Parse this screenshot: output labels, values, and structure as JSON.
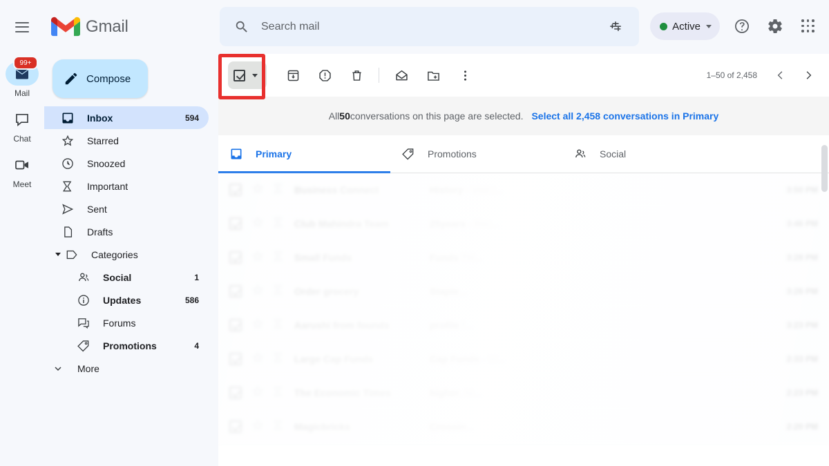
{
  "app": {
    "brand": "Gmail",
    "menu_icon": "hamburger-icon"
  },
  "search": {
    "placeholder": "Search mail",
    "value": "",
    "icon": "search-icon",
    "options_icon": "search-options-icon"
  },
  "header": {
    "status_label": "Active",
    "status_color": "#1e8e3e",
    "help_label": "Support",
    "settings_label": "Settings",
    "apps_label": "Google apps"
  },
  "rail": {
    "items": [
      {
        "label": "Mail",
        "icon": "mail-icon",
        "badge": "99+",
        "active": true
      },
      {
        "label": "Chat",
        "icon": "chat-icon",
        "badge": "",
        "active": false
      },
      {
        "label": "Meet",
        "icon": "meet-icon",
        "badge": "",
        "active": false
      }
    ]
  },
  "sidebar": {
    "compose_label": "Compose",
    "items": [
      {
        "label": "Inbox",
        "count": "594",
        "icon": "inbox-icon",
        "active": true,
        "bold": true,
        "level": "top"
      },
      {
        "label": "Starred",
        "count": "",
        "icon": "star-icon",
        "active": false,
        "bold": false,
        "level": "top"
      },
      {
        "label": "Snoozed",
        "count": "",
        "icon": "clock-icon",
        "active": false,
        "bold": false,
        "level": "top"
      },
      {
        "label": "Important",
        "count": "",
        "icon": "important-icon",
        "active": false,
        "bold": false,
        "level": "top"
      },
      {
        "label": "Sent",
        "count": "",
        "icon": "send-icon",
        "active": false,
        "bold": false,
        "level": "top"
      },
      {
        "label": "Drafts",
        "count": "",
        "icon": "draft-icon",
        "active": false,
        "bold": false,
        "level": "top"
      },
      {
        "label": "Categories",
        "count": "",
        "icon": "label-icon",
        "active": false,
        "bold": false,
        "level": "group"
      },
      {
        "label": "Social",
        "count": "1",
        "icon": "people-icon",
        "active": false,
        "bold": true,
        "level": "sub"
      },
      {
        "label": "Updates",
        "count": "586",
        "icon": "info-icon",
        "active": false,
        "bold": true,
        "level": "sub"
      },
      {
        "label": "Forums",
        "count": "",
        "icon": "forum-icon",
        "active": false,
        "bold": false,
        "level": "sub"
      },
      {
        "label": "Promotions",
        "count": "4",
        "icon": "tag-icon",
        "active": false,
        "bold": true,
        "level": "sub"
      },
      {
        "label": "More",
        "count": "",
        "icon": "expand-icon",
        "active": false,
        "bold": false,
        "level": "more"
      }
    ]
  },
  "toolbar": {
    "select_all_icon": "checkbox-checked-icon",
    "select_all_caret": "chevron-down-icon",
    "buttons": [
      {
        "label": "Archive",
        "icon": "archive-icon"
      },
      {
        "label": "Report spam",
        "icon": "report-spam-icon"
      },
      {
        "label": "Delete",
        "icon": "trash-icon"
      },
      {
        "label": "Mark as unread",
        "icon": "mark-unread-icon"
      },
      {
        "label": "Move to",
        "icon": "move-to-folder-icon"
      },
      {
        "label": "More",
        "icon": "more-vert-icon"
      }
    ],
    "pager_text": "1–50 of 2,458",
    "prev_label": "Newer",
    "next_label": "Older"
  },
  "banner": {
    "prefix": "All ",
    "count": "50",
    "suffix": " conversations on this page are selected.",
    "link": "Select all 2,458 conversations in Primary",
    "link_color": "#1a73e8"
  },
  "tabs": [
    {
      "label": "Primary",
      "icon": "inbox-tab-icon",
      "active": true
    },
    {
      "label": "Promotions",
      "icon": "tag-tab-icon",
      "active": false
    },
    {
      "label": "Social",
      "icon": "people-tab-icon",
      "active": false
    }
  ],
  "emails": [
    {
      "sender": "Business Connect",
      "subject": "History",
      "snippet": " - Visit t...",
      "time": "3:50 PM"
    },
    {
      "sender": "Club Mahindra Team",
      "subject": "25years",
      "snippet": " - Rec...",
      "time": "3:46 PM"
    },
    {
      "sender": "Small Funds",
      "subject": "Funds",
      "snippet": " TH...",
      "time": "3:28 PM"
    },
    {
      "sender": "Order grocery",
      "subject": "Staple",
      "snippet": "...",
      "time": "3:26 PM"
    },
    {
      "sender": "Aarushi from founds",
      "subject": "profile",
      "snippet": " f...",
      "time": "3:23 PM"
    },
    {
      "sender": "Large Cap Funds",
      "subject": "Cap Funds",
      "snippet": " - W...",
      "time": "2:33 PM"
    },
    {
      "sender": "The Economic Times",
      "subject": "higher",
      "snippet": ", Ni...",
      "time": "2:23 PM"
    },
    {
      "sender": "Magicbricks",
      "subject": "Crossin",
      "snippet": "...",
      "time": "2:20 PM"
    }
  ],
  "annotation": {
    "highlight_color": "#e8302e",
    "target": "select-all-checkbox"
  }
}
